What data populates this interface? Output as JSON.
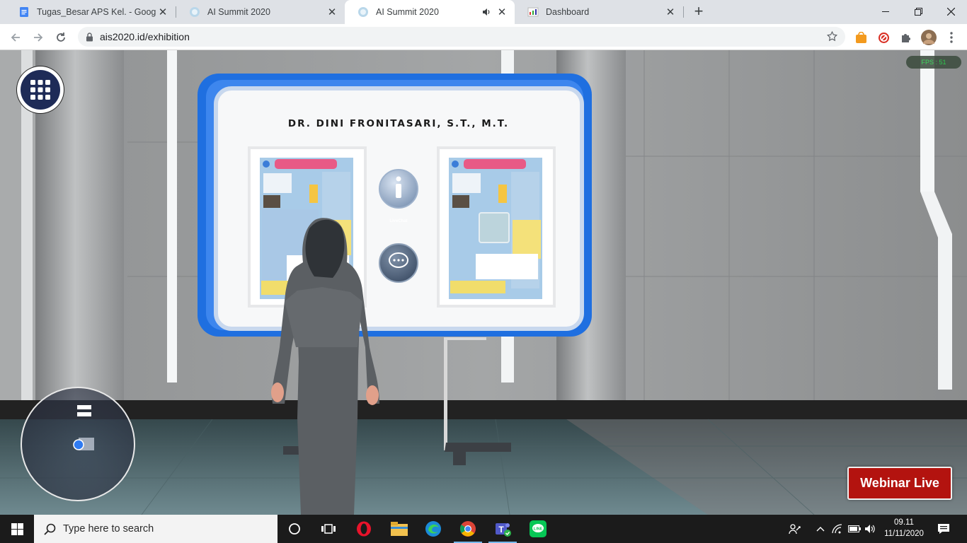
{
  "browser": {
    "tabs": [
      {
        "title": "Tugas_Besar APS Kel. - Google Do",
        "favicon": "google-docs-icon",
        "active": false
      },
      {
        "title": "AI Summit 2020",
        "favicon": "ai-summit-icon",
        "active": false
      },
      {
        "title": "AI Summit 2020",
        "favicon": "ai-summit-icon",
        "active": true,
        "audio": true
      },
      {
        "title": "Dashboard",
        "favicon": "dashboard-icon",
        "active": false
      }
    ],
    "url": "ais2020.id/exhibition"
  },
  "scene": {
    "fps": "FPS : 51",
    "booth_title": "DR. DINI FRONITASARI, S.T., M.T.",
    "livechat_label": "LiveChat",
    "webinar_button": "Webinar Live"
  },
  "taskbar": {
    "search_placeholder": "Type here to search",
    "time": "09.11",
    "date": "11/11/2020"
  },
  "colors": {
    "booth_blue": "#1f6fe0",
    "webinar_red": "#b3130f",
    "fps_green": "#1ed443"
  }
}
